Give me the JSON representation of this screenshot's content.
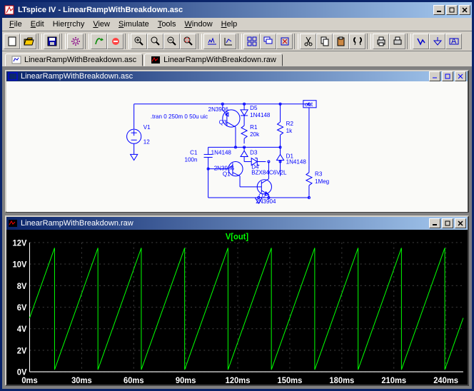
{
  "app": {
    "title": "LTspice IV - LinearRampWithBreakdown.asc"
  },
  "menu": {
    "file": "File",
    "edit": "Edit",
    "hierarchy": "Hierarchy",
    "view": "View",
    "simulate": "Simulate",
    "tools": "Tools",
    "window": "Window",
    "help": "Help"
  },
  "tabs": {
    "asc": "LinearRampWithBreakdown.asc",
    "raw": "LinearRampWithBreakdown.raw"
  },
  "mdi": {
    "asc_title": "LinearRampWithBreakdown.asc",
    "raw_title": "LinearRampWithBreakdown.raw"
  },
  "schem": {
    "tran": ".tran 0 250m 0 50u uic",
    "V1": "V1",
    "V1val": "12",
    "Q3": "Q3",
    "Q3part": "2N3906",
    "D5": "D5",
    "D5part": "1N4148",
    "R1": "R1",
    "R1val": "20k",
    "R2": "R2",
    "R2val": "1k",
    "C1": "C1",
    "C1val": "100n",
    "D3": "D3",
    "D3part": "1N4148",
    "D4": "D4",
    "D4part": "BZX84C6V2L",
    "D1": "D1",
    "D1part": "1N4148",
    "Q1": "Q1",
    "Q1part": "2N3906",
    "Q2": "Q2",
    "Q2part": "2N3904",
    "R3": "R3",
    "R3val": "1Meg",
    "out": "out"
  },
  "chart_data": {
    "type": "line",
    "title": "V[out]",
    "xlabel": "ms",
    "ylabel": "V",
    "x_ticks": [
      "0ms",
      "30ms",
      "60ms",
      "90ms",
      "120ms",
      "150ms",
      "180ms",
      "210ms",
      "240ms"
    ],
    "y_ticks": [
      "0V",
      "2V",
      "4V",
      "6V",
      "8V",
      "10V",
      "12V"
    ],
    "xlim": [
      0,
      250
    ],
    "ylim": [
      0,
      12
    ],
    "period_ms": 25,
    "vmin": 0.2,
    "vmax": 11.5,
    "v0": 5.0
  }
}
